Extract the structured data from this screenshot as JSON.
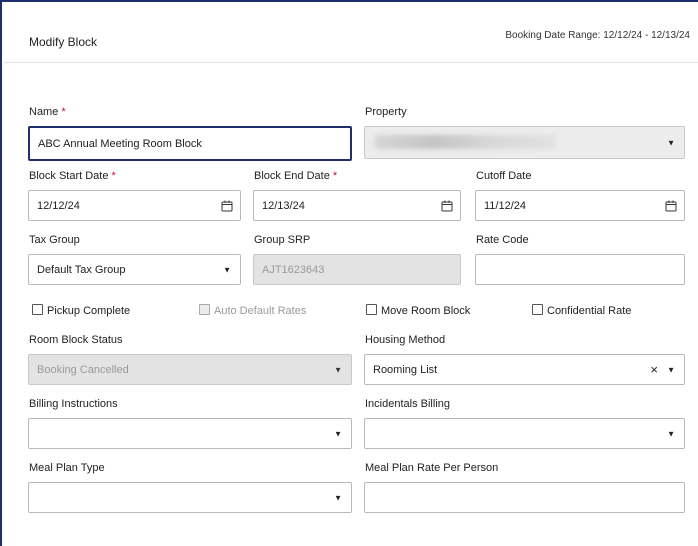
{
  "header": {
    "title": "Modify Block",
    "booking_range_label": "Booking Date Range:",
    "booking_range_value": "12/12/24 - 12/13/24"
  },
  "form": {
    "name": {
      "label": "Name",
      "required_mark": "*",
      "value": "ABC Annual Meeting Room Block"
    },
    "property": {
      "label": "Property",
      "value": ""
    },
    "block_start_date": {
      "label": "Block Start Date",
      "required_mark": "*",
      "value": "12/12/24"
    },
    "block_end_date": {
      "label": "Block End Date",
      "required_mark": "*",
      "value": "12/13/24"
    },
    "cutoff_date": {
      "label": "Cutoff Date",
      "value": "11/12/24"
    },
    "tax_group": {
      "label": "Tax Group",
      "value": "Default Tax Group"
    },
    "group_srp": {
      "label": "Group SRP",
      "value": "AJT1623643"
    },
    "rate_code": {
      "label": "Rate Code",
      "value": ""
    },
    "checkboxes": {
      "pickup_complete": {
        "label": "Pickup Complete",
        "checked": false
      },
      "auto_default_rates": {
        "label": "Auto Default Rates",
        "checked": false,
        "disabled": true
      },
      "move_room_block": {
        "label": "Move Room Block",
        "checked": false
      },
      "confidential_rate": {
        "label": "Confidential Rate",
        "checked": false
      }
    },
    "room_block_status": {
      "label": "Room Block Status",
      "value": "Booking Cancelled"
    },
    "housing_method": {
      "label": "Housing Method",
      "value": "Rooming List",
      "clear_glyph": "×"
    },
    "billing_instructions": {
      "label": "Billing Instructions",
      "value": ""
    },
    "incidentals_billing": {
      "label": "Incidentals Billing",
      "value": ""
    },
    "meal_plan_type": {
      "label": "Meal Plan Type",
      "value": ""
    },
    "meal_plan_rate": {
      "label": "Meal Plan Rate Per Person",
      "value": ""
    }
  },
  "icons": {
    "caret": "▼",
    "calendar": "calendar-icon",
    "close": "close-icon"
  },
  "colors": {
    "focus_border": "#1f2f6b",
    "required": "#c0152f",
    "disabled_bg": "#e3e3e3"
  }
}
